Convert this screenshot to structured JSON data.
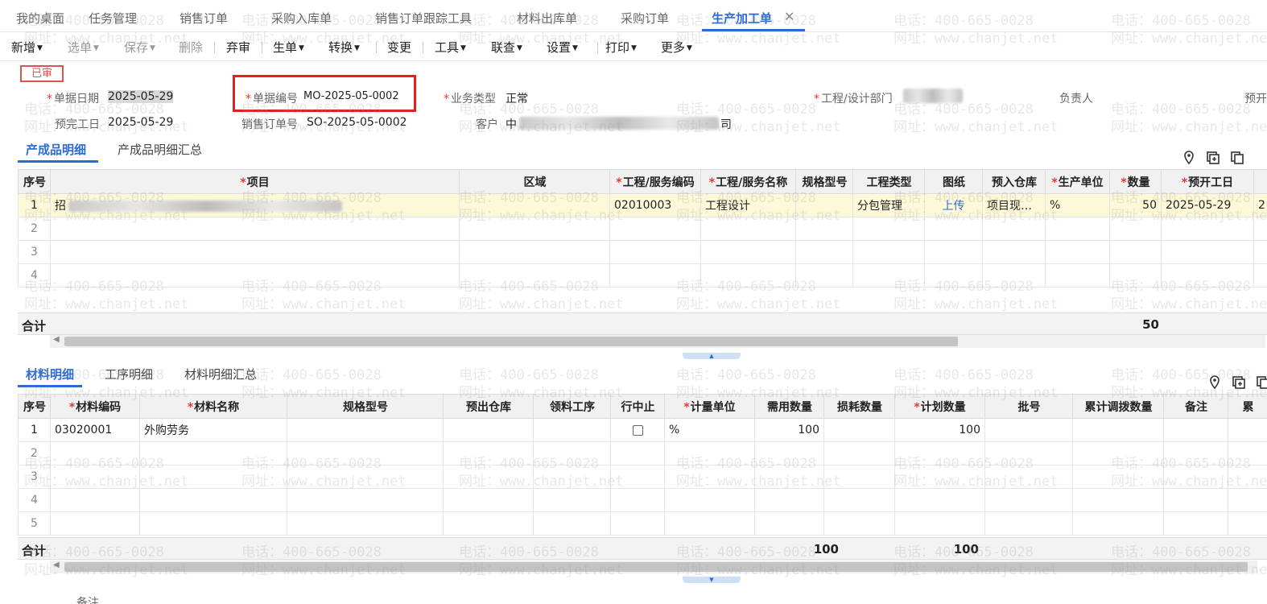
{
  "tabs": [
    {
      "label": "我的桌面"
    },
    {
      "label": "任务管理"
    },
    {
      "label": "销售订单"
    },
    {
      "label": "采购入库单"
    },
    {
      "label": "销售订单跟踪工具"
    },
    {
      "label": "材料出库单"
    },
    {
      "label": "采购订单"
    },
    {
      "label": "生产加工单"
    }
  ],
  "toolbar": {
    "new": "新增",
    "select": "选单",
    "save": "保存",
    "delete": "删除",
    "abandon": "弃审",
    "generate": "生单",
    "convert": "转换",
    "change": "变更",
    "tools": "工具",
    "query": "联查",
    "settings": "设置",
    "print": "打印",
    "more": "更多"
  },
  "header": {
    "status": "已审",
    "doc_date_label": "单据日期",
    "doc_date": "2025-05-29",
    "doc_no_label": "单据编号",
    "doc_no": "MO-2025-05-0002",
    "biz_type_label": "业务类型",
    "biz_type": "正常",
    "dept_label": "工程/设计部门",
    "owner_label": "负责人",
    "extra_label": "预开",
    "finish_date_label": "预完工日",
    "finish_date": "2025-05-29",
    "so_no_label": "销售订单号",
    "so_no": "SO-2025-05-0002",
    "customer_label": "客户",
    "customer_prefix": "中",
    "customer_suffix": "司"
  },
  "product_tabs": [
    "产成品明细",
    "产成品明细汇总"
  ],
  "product_table": {
    "columns": [
      {
        "label": "序号",
        "req": ""
      },
      {
        "label": "项目",
        "req": "*"
      },
      {
        "label": "区域",
        "req": ""
      },
      {
        "label": "工程/服务编码",
        "req": "*"
      },
      {
        "label": "工程/服务名称",
        "req": "*"
      },
      {
        "label": "规格型号",
        "req": ""
      },
      {
        "label": "工程类型",
        "req": ""
      },
      {
        "label": "图纸",
        "req": ""
      },
      {
        "label": "预入仓库",
        "req": ""
      },
      {
        "label": "生产单位",
        "req": "*"
      },
      {
        "label": "数量",
        "req": "*"
      },
      {
        "label": "预开工日",
        "req": "*"
      }
    ],
    "row1": {
      "idx": "1",
      "project_prefix": "招",
      "area": "",
      "code": "02010003",
      "name": "工程设计",
      "spec": "",
      "type": "分包管理",
      "drawing": "上传",
      "warehouse": "项目现…",
      "unit": "%",
      "qty": "50",
      "start_date": "2025-05-29",
      "overflow": "2"
    },
    "empty_rows": [
      "2",
      "3",
      "4"
    ],
    "total_label": "合计",
    "total_qty": "50"
  },
  "material_tabs": [
    "材料明细",
    "工序明细",
    "材料明细汇总"
  ],
  "material_table": {
    "columns": [
      {
        "label": "序号",
        "req": ""
      },
      {
        "label": "材料编码",
        "req": "*"
      },
      {
        "label": "材料名称",
        "req": "*"
      },
      {
        "label": "规格型号",
        "req": ""
      },
      {
        "label": "预出仓库",
        "req": ""
      },
      {
        "label": "领料工序",
        "req": ""
      },
      {
        "label": "行中止",
        "req": ""
      },
      {
        "label": "计量单位",
        "req": "*"
      },
      {
        "label": "需用数量",
        "req": ""
      },
      {
        "label": "损耗数量",
        "req": ""
      },
      {
        "label": "计划数量",
        "req": "*"
      },
      {
        "label": "批号",
        "req": ""
      },
      {
        "label": "累计调拨数量",
        "req": ""
      },
      {
        "label": "备注",
        "req": ""
      },
      {
        "label": "累",
        "req": ""
      }
    ],
    "row1": {
      "idx": "1",
      "code": "03020001",
      "name": "外购劳务",
      "unit": "%",
      "need_qty": "100",
      "plan_qty": "100"
    },
    "empty_rows": [
      "2",
      "3",
      "4",
      "5"
    ],
    "total_label": "合计",
    "total_need": "100",
    "total_plan": "100"
  },
  "footer": {
    "remark_label": "备注"
  },
  "watermark": {
    "phone": "电话：400-665-0028",
    "site": "网址：www.chanjet.net"
  }
}
